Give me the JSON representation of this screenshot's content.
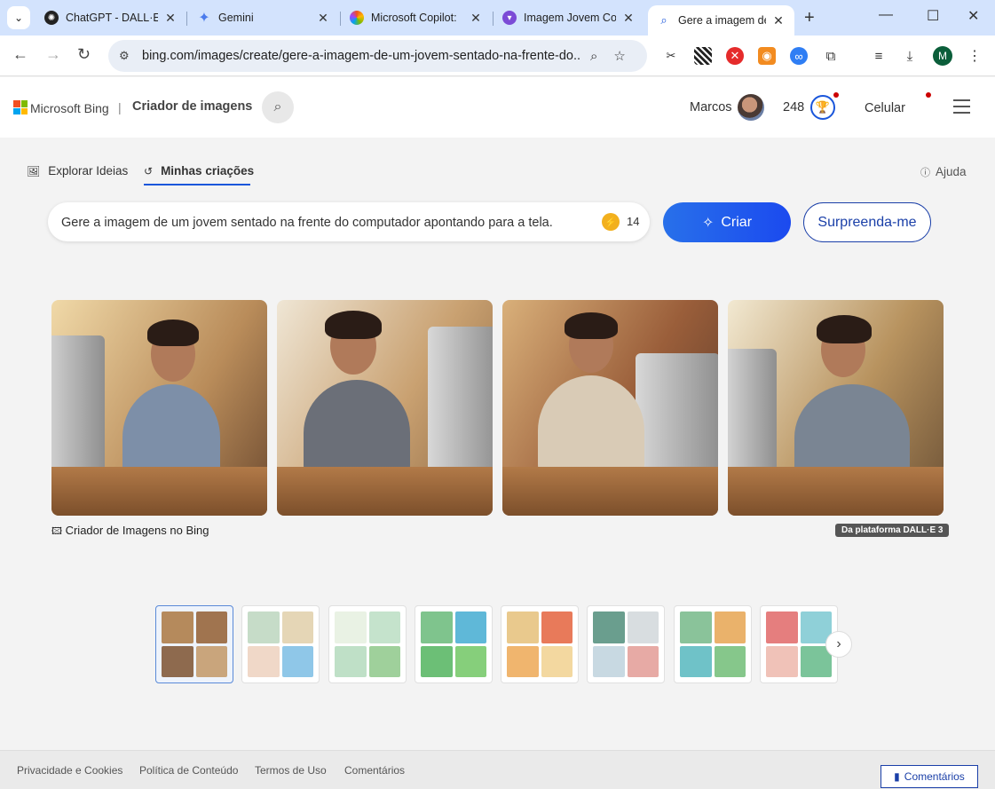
{
  "browser": {
    "tabs": [
      {
        "title": "ChatGPT - DALL·E",
        "icon": "chatgpt-icon"
      },
      {
        "title": "Gemini",
        "icon": "gemini-icon"
      },
      {
        "title": "Microsoft Copilot:",
        "icon": "copilot-icon"
      },
      {
        "title": "Imagem Jovem Co",
        "icon": "app-icon"
      },
      {
        "title": "Gere a imagem de",
        "icon": "search-icon"
      }
    ],
    "close_glyph": "✕",
    "new_tab": "+",
    "url": "bing.com/images/create/gere-a-imagem-de-um-jovem-sentado-na-frente-do...",
    "profile_initial": "M"
  },
  "header": {
    "brand": "Microsoft Bing",
    "separator": "|",
    "product": "Criador de imagens",
    "user_name": "Marcos",
    "points": "248",
    "mobile": "Celular"
  },
  "nav": {
    "explore": "Explorar Ideias",
    "mine": "Minhas criações",
    "help": "Ajuda"
  },
  "prompt": {
    "text": "Gere a imagem de um jovem sentado na frente do computador apontando para a tela.",
    "boosts": "14",
    "create_label": "Criar",
    "surprise_label": "Surpreenda-me"
  },
  "gallery": {
    "caption": "Criador de Imagens no Bing",
    "badge": "Da plataforma DALL·E 3"
  },
  "footer": {
    "links": [
      "Privacidade e Cookies",
      "Política de Conteúdo",
      "Termos de Uso",
      "Comentários"
    ],
    "feedback": "Comentários"
  }
}
